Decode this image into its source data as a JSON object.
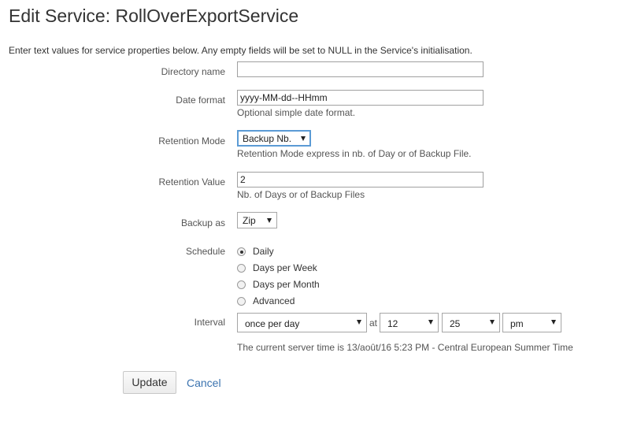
{
  "page": {
    "title": "Edit Service: RollOverExportService",
    "intro": "Enter text values for service properties below. Any empty fields will be set to NULL in the Service's initialisation."
  },
  "fields": {
    "directory": {
      "label": "Directory name",
      "value": ""
    },
    "date_format": {
      "label": "Date format",
      "value": "yyyy-MM-dd--HHmm",
      "help": "Optional simple date format."
    },
    "retention_mode": {
      "label": "Retention Mode",
      "selected": "Backup Nb.",
      "help": "Retention Mode express in nb. of Day or of Backup File."
    },
    "retention_value": {
      "label": "Retention Value",
      "value": "2",
      "help": "Nb. of Days or of Backup Files"
    },
    "backup_as": {
      "label": "Backup as",
      "selected": "Zip"
    }
  },
  "schedule": {
    "label": "Schedule",
    "options": [
      "Daily",
      "Days per Week",
      "Days per Month",
      "Advanced"
    ],
    "selected_index": 0
  },
  "interval": {
    "label": "Interval",
    "frequency": "once per day",
    "at": "at",
    "hour": "12",
    "minute": "25",
    "ampm": "pm",
    "server_time": "The current server time is 13/août/16 5:23 PM - Central European Summer Time"
  },
  "actions": {
    "update": "Update",
    "cancel": "Cancel"
  }
}
